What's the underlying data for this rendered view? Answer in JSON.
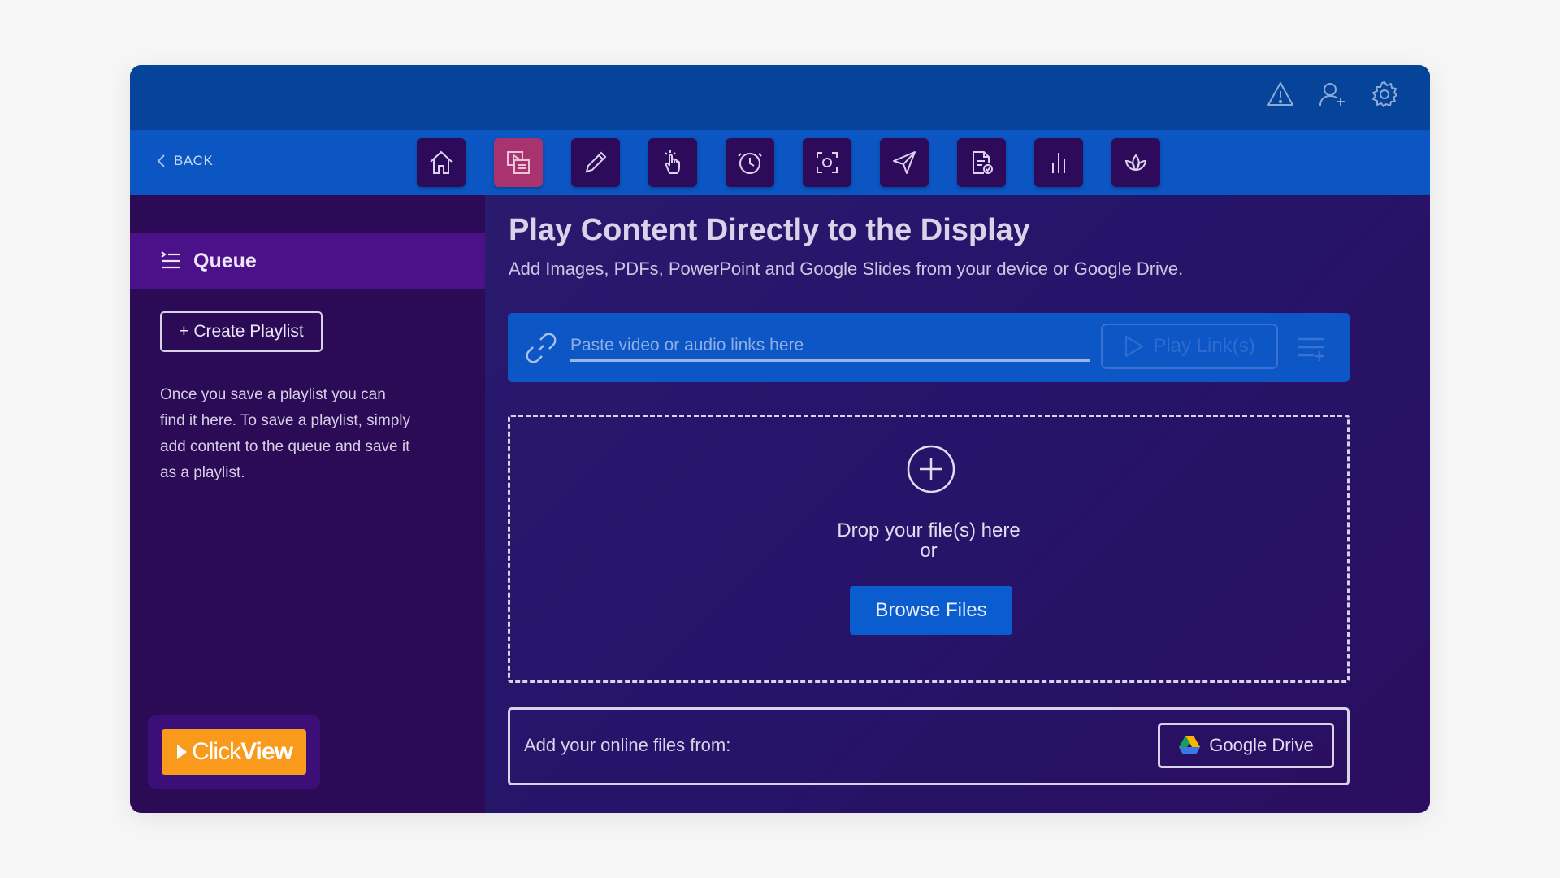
{
  "topbar": {
    "icons": [
      "alert-icon",
      "add-user-icon",
      "gear-icon"
    ]
  },
  "nav": {
    "back_label": "BACK",
    "tools": [
      {
        "icon": "home-icon",
        "active": false
      },
      {
        "icon": "media-play-icon",
        "active": true
      },
      {
        "icon": "pencil-icon",
        "active": false
      },
      {
        "icon": "touch-pointer-icon",
        "active": false
      },
      {
        "icon": "clock-icon",
        "active": false
      },
      {
        "icon": "screen-capture-icon",
        "active": false
      },
      {
        "icon": "send-icon",
        "active": false
      },
      {
        "icon": "document-check-icon",
        "active": false
      },
      {
        "icon": "bar-chart-icon",
        "active": false
      },
      {
        "icon": "lotus-icon",
        "active": false
      }
    ]
  },
  "sidebar": {
    "queue_label": "Queue",
    "create_playlist_label": "+ Create Playlist",
    "help_text": "Once you  save a playlist you can find it here. To save a playlist, simply add content to the queue and save it as a playlist.",
    "logo": {
      "part1": "Click",
      "part2": "View"
    }
  },
  "main": {
    "title": "Play Content Directly to the Display",
    "subtitle": "Add Images, PDFs, PowerPoint and Google Slides from your device or Google Drive.",
    "link_input": {
      "value": "",
      "placeholder": "Paste video or audio links here"
    },
    "play_links_label": "Play Link(s)",
    "dropzone": {
      "line1": "Drop your file(s) here",
      "line2": "or",
      "browse_label": "Browse Files"
    },
    "online": {
      "label": "Add your online files from:",
      "google_drive_label": "Google Drive"
    }
  },
  "colors": {
    "topbar": "#06449a",
    "navbar": "#0b56c3",
    "tool_bg": "#2e0b5a",
    "tool_active": "#a8336e",
    "sidebar": "#2b0b56",
    "queue_active": "#4a1188",
    "accent_blue": "#0a5ccf",
    "logo_orange": "#f99a1d"
  }
}
